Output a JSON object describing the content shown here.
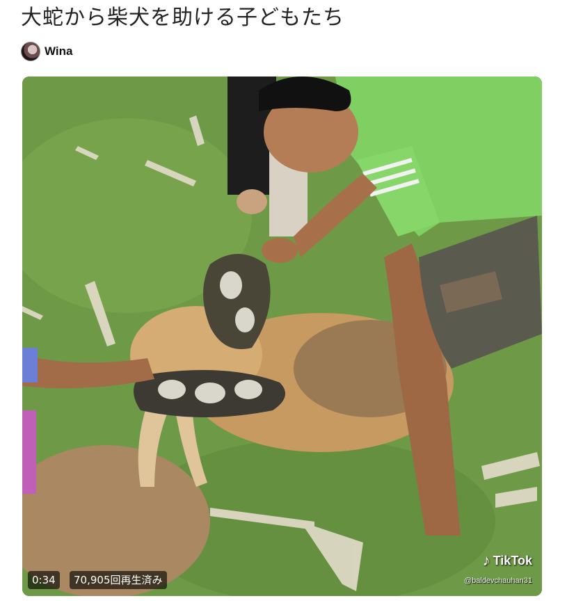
{
  "post": {
    "title": "大蛇から柴犬を助ける子どもたち",
    "author": "Wina"
  },
  "video": {
    "duration": "0:34",
    "views": "70,905回再生済み",
    "watermark_brand": "TikTok",
    "watermark_handle": "@baldevchauhan31",
    "icons": {
      "brand": "tiktok-note-icon"
    }
  }
}
